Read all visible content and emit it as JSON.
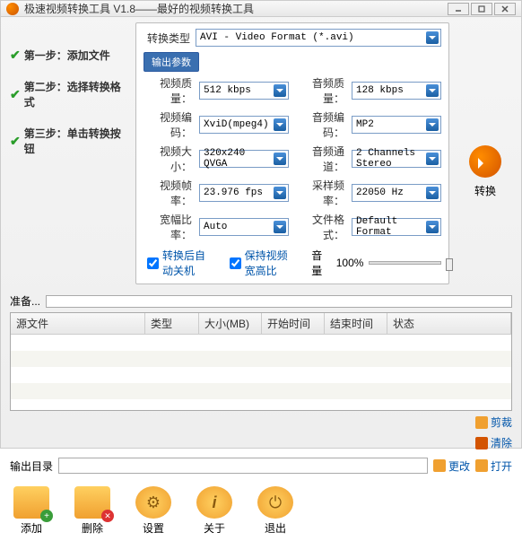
{
  "window": {
    "title": "极速视频转换工具 V1.8——最好的视频转换工具"
  },
  "steps": [
    {
      "label": "第一步：添加文件"
    },
    {
      "label": "第二步：选择转换格式"
    },
    {
      "label": "第三步：单击转换按钮"
    }
  ],
  "type_label": "转换类型",
  "type_value": "AVI - Video Format (*.avi)",
  "tab_output": "输出参数",
  "params": {
    "video_quality_label": "视频质量：",
    "video_quality_value": "512 kbps",
    "audio_quality_label": "音频质量：",
    "audio_quality_value": "128 kbps",
    "video_codec_label": "视频编码：",
    "video_codec_value": "XviD(mpeg4)",
    "audio_codec_label": "音频编码：",
    "audio_codec_value": "MP2",
    "video_size_label": "视频大小：",
    "video_size_value": "320x240 QVGA",
    "audio_channel_label": "音频通道：",
    "audio_channel_value": "2 Channels Stereo",
    "video_fps_label": "视频帧率：",
    "video_fps_value": "23.976 fps",
    "sample_rate_label": "采样频率：",
    "sample_rate_value": "22050 Hz",
    "aspect_label": "宽幅比率：",
    "aspect_value": "Auto",
    "file_format_label": "文件格式：",
    "file_format_value": "Default Format"
  },
  "checks": {
    "shutdown": "转换后自动关机",
    "keep_ratio": "保持视频宽高比"
  },
  "volume_label": "音量",
  "volume_value": "100%",
  "convert_label": "转换",
  "prepare_label": "准备...",
  "table": {
    "columns": [
      "源文件",
      "类型",
      "大小(MB)",
      "开始时间",
      "结束时间",
      "状态"
    ],
    "rows": []
  },
  "crop_label": "剪裁",
  "clear_label": "清除",
  "output_label": "输出目录",
  "change_label": "更改",
  "open_label": "打开",
  "toolbar": {
    "add": "添加",
    "delete": "删除",
    "settings": "设置",
    "about": "关于",
    "exit": "退出"
  }
}
